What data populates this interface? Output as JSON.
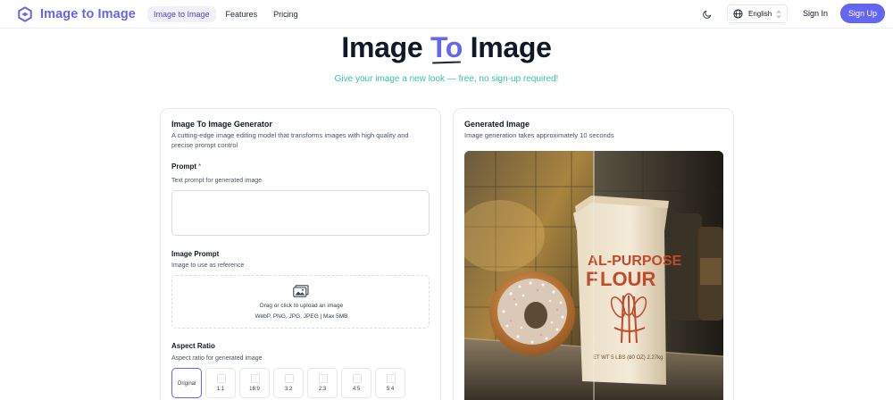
{
  "nav": {
    "brand": "Image to Image",
    "links": [
      {
        "label": "Image to Image",
        "active": true
      },
      {
        "label": "Features",
        "active": false
      },
      {
        "label": "Pricing",
        "active": false
      }
    ],
    "theme_icon": "moon-icon",
    "language": "English",
    "sign_in": "Sign In",
    "sign_up": "Sign Up"
  },
  "hero": {
    "title_before": "Image ",
    "title_accent": "To",
    "title_after": " Image",
    "subtitle": "Give your image a new look — free, no sign-up required!"
  },
  "generator": {
    "title": "Image To Image Generator",
    "description": "A cutting-edge image editing model that transforms images with high quality and precise prompt control",
    "prompt_label": "Prompt",
    "prompt_required": "*",
    "prompt_hint": "Text prompt for generated image",
    "prompt_value": "",
    "image_prompt_label": "Image Prompt",
    "image_prompt_hint": "Image to use as reference",
    "upload_text": "Drag or click to upload an image",
    "upload_formats": "WebP, PNG, JPG, JPEG | Max 5MB",
    "aspect_label": "Aspect Ratio",
    "aspect_hint": "Aspect ratio for generated image",
    "ratios": [
      "Original",
      "1:1",
      "16:9",
      "3:2",
      "2:3",
      "4:5",
      "5:4"
    ],
    "selected_ratio": "Original"
  },
  "output": {
    "title": "Generated Image",
    "subtitle": "Image generation takes approximately 10 seconds",
    "image": {
      "bag_line1": "L-PURPOSE",
      "bag_line1_prefix": "A",
      "bag_line2_prefix": "F",
      "bag_line2": "LOUR",
      "bag_weight": "ET WT 5 LBS (80 OZ) 2.27kg"
    }
  },
  "colors": {
    "brand": "#6366f1",
    "subtitle": "#34c3a8",
    "required": "#dc2626"
  }
}
